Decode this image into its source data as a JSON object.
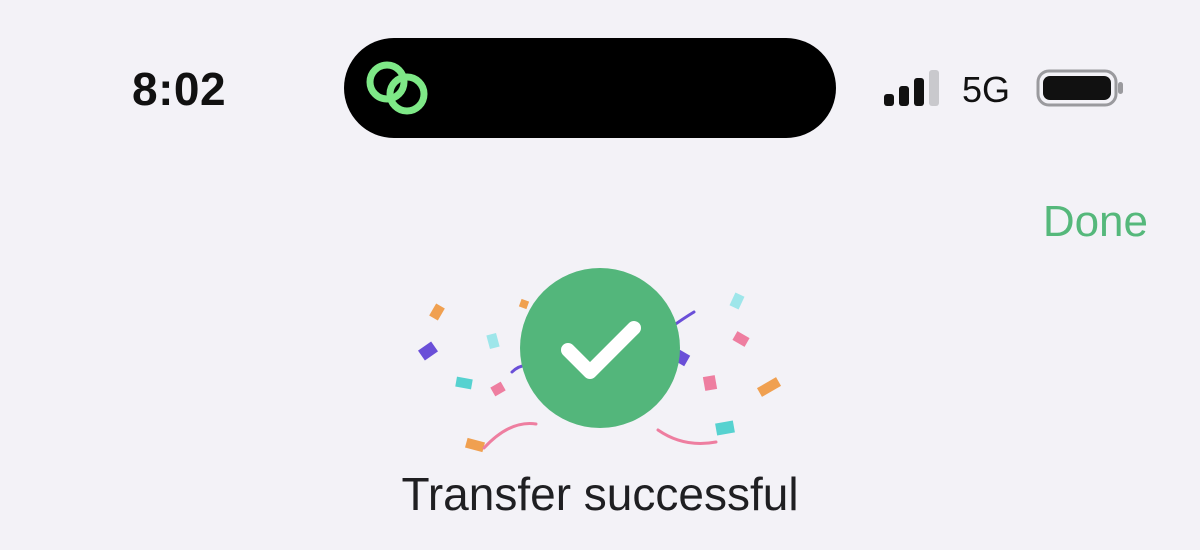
{
  "status_bar": {
    "time": "8:02",
    "network": "5G",
    "signal_icon": "cellular-signal-icon",
    "battery_icon": "battery-icon",
    "island_icon": "linked-rings-icon"
  },
  "header": {
    "done_label": "Done"
  },
  "success": {
    "icon": "checkmark-icon",
    "title": "Transfer successful"
  },
  "colors": {
    "accent": "#55b87b",
    "success_circle": "#53b67b",
    "background": "#f3f2f7",
    "island": "#000000",
    "island_icon": "#7ee887"
  }
}
